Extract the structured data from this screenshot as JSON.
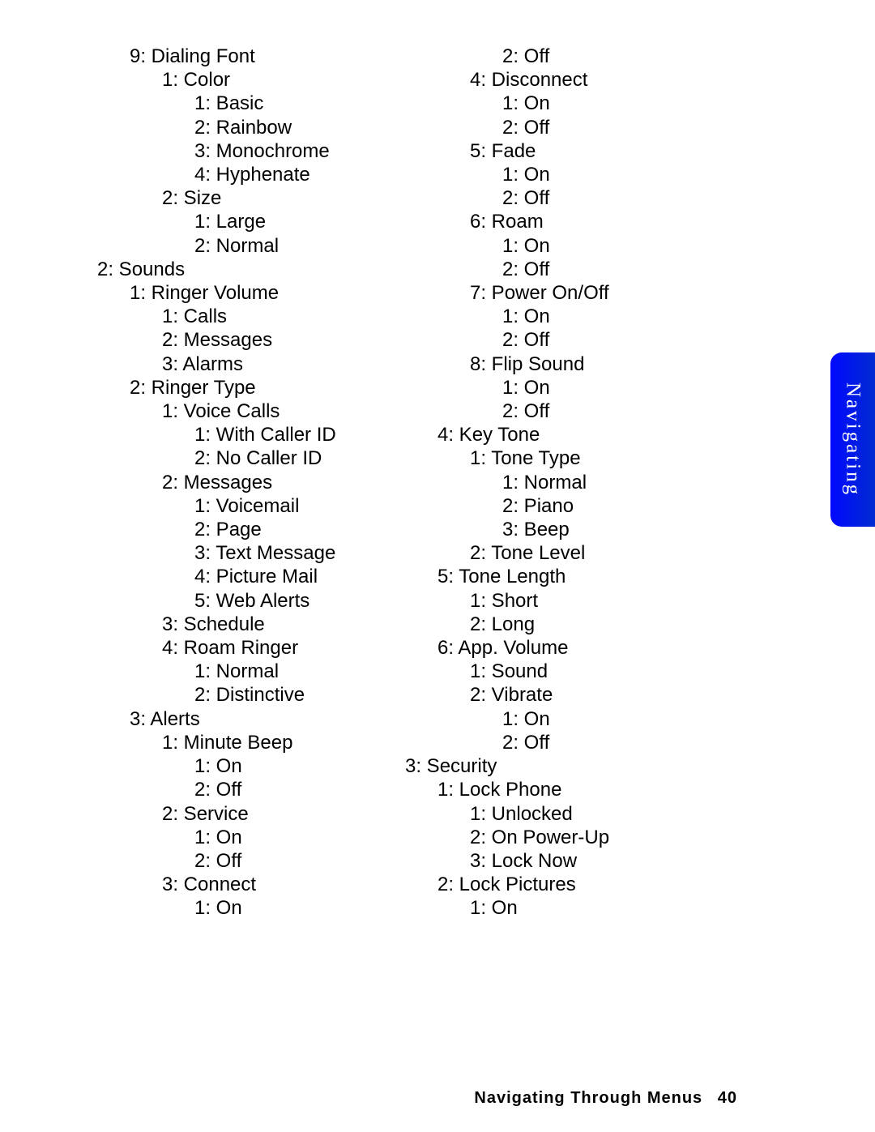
{
  "tab_label": "Navigating",
  "footer_section": "Navigating Through Menus",
  "footer_page": "40",
  "col1": [
    {
      "i": 1,
      "t": "9: Dialing Font"
    },
    {
      "i": 2,
      "t": "1: Color"
    },
    {
      "i": 3,
      "t": "1: Basic"
    },
    {
      "i": 3,
      "t": "2: Rainbow"
    },
    {
      "i": 3,
      "t": "3: Monochrome"
    },
    {
      "i": 3,
      "t": "4: Hyphenate"
    },
    {
      "i": 2,
      "t": "2: Size"
    },
    {
      "i": 3,
      "t": "1: Large"
    },
    {
      "i": 3,
      "t": "2: Normal"
    },
    {
      "i": 0,
      "t": "2: Sounds"
    },
    {
      "i": 1,
      "t": "1: Ringer Volume"
    },
    {
      "i": 2,
      "t": "1: Calls"
    },
    {
      "i": 2,
      "t": "2: Messages"
    },
    {
      "i": 2,
      "t": "3: Alarms"
    },
    {
      "i": 1,
      "t": "2: Ringer Type"
    },
    {
      "i": 2,
      "t": "1: Voice Calls"
    },
    {
      "i": 3,
      "t": "1: With Caller ID"
    },
    {
      "i": 3,
      "t": "2: No Caller ID"
    },
    {
      "i": 2,
      "t": "2: Messages"
    },
    {
      "i": 3,
      "t": "1: Voicemail"
    },
    {
      "i": 3,
      "t": "2: Page"
    },
    {
      "i": 3,
      "t": "3: Text Message"
    },
    {
      "i": 3,
      "t": "4: Picture Mail"
    },
    {
      "i": 3,
      "t": "5: Web Alerts"
    },
    {
      "i": 2,
      "t": "3: Schedule"
    },
    {
      "i": 2,
      "t": "4: Roam Ringer"
    },
    {
      "i": 3,
      "t": "1: Normal"
    },
    {
      "i": 3,
      "t": "2: Distinctive"
    },
    {
      "i": 1,
      "t": "3: Alerts"
    },
    {
      "i": 2,
      "t": "1: Minute Beep"
    },
    {
      "i": 3,
      "t": "1: On"
    },
    {
      "i": 3,
      "t": "2: Off"
    },
    {
      "i": 2,
      "t": "2: Service"
    },
    {
      "i": 3,
      "t": "1: On"
    },
    {
      "i": 3,
      "t": "2: Off"
    },
    {
      "i": 2,
      "t": "3: Connect"
    },
    {
      "i": 3,
      "t": "1: On"
    }
  ],
  "col2": [
    {
      "i": 3,
      "t": "2: Off"
    },
    {
      "i": 2,
      "t": "4: Disconnect"
    },
    {
      "i": 3,
      "t": "1: On"
    },
    {
      "i": 3,
      "t": "2: Off"
    },
    {
      "i": 2,
      "t": "5: Fade"
    },
    {
      "i": 3,
      "t": "1: On"
    },
    {
      "i": 3,
      "t": "2: Off"
    },
    {
      "i": 2,
      "t": "6: Roam"
    },
    {
      "i": 3,
      "t": "1: On"
    },
    {
      "i": 3,
      "t": "2: Off"
    },
    {
      "i": 2,
      "t": "7: Power On/Off"
    },
    {
      "i": 3,
      "t": "1: On"
    },
    {
      "i": 3,
      "t": "2: Off"
    },
    {
      "i": 2,
      "t": "8: Flip Sound"
    },
    {
      "i": 3,
      "t": "1: On"
    },
    {
      "i": 3,
      "t": "2: Off"
    },
    {
      "i": 1,
      "t": "4: Key Tone"
    },
    {
      "i": 2,
      "t": "1: Tone Type"
    },
    {
      "i": 3,
      "t": "1: Normal"
    },
    {
      "i": 3,
      "t": "2: Piano"
    },
    {
      "i": 3,
      "t": "3: Beep"
    },
    {
      "i": 2,
      "t": "2: Tone Level"
    },
    {
      "i": 1,
      "t": "5: Tone Length"
    },
    {
      "i": 2,
      "t": "1: Short"
    },
    {
      "i": 2,
      "t": "2: Long"
    },
    {
      "i": 1,
      "t": "6: App. Volume"
    },
    {
      "i": 2,
      "t": "1: Sound"
    },
    {
      "i": 2,
      "t": "2: Vibrate"
    },
    {
      "i": 3,
      "t": "1: On"
    },
    {
      "i": 3,
      "t": "2: Off"
    },
    {
      "i": 0,
      "t": "3: Security"
    },
    {
      "i": 1,
      "t": "1: Lock Phone"
    },
    {
      "i": 2,
      "t": "1: Unlocked"
    },
    {
      "i": 2,
      "t": "2: On Power-Up"
    },
    {
      "i": 2,
      "t": "3: Lock Now"
    },
    {
      "i": 1,
      "t": "2: Lock Pictures"
    },
    {
      "i": 2,
      "t": "1: On"
    }
  ]
}
